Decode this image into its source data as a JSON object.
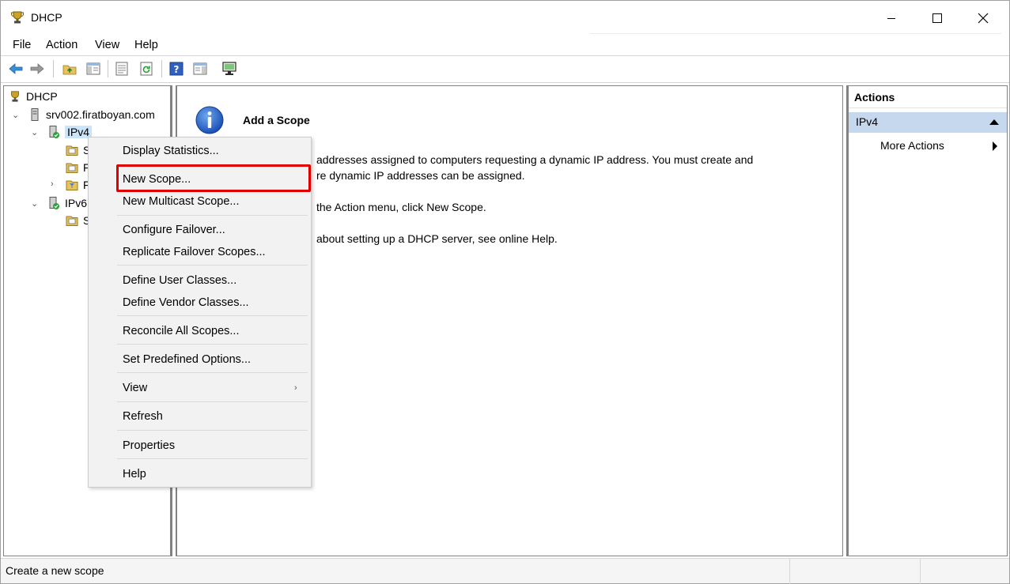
{
  "window": {
    "title": "DHCP"
  },
  "titlebar": {
    "min_icon": "minimize-icon",
    "max_icon": "maximize-icon",
    "close_icon": "close-icon"
  },
  "menubar": {
    "items": [
      "File",
      "Action",
      "View",
      "Help"
    ]
  },
  "toolbar": {
    "buttons": [
      "back-arrow-icon",
      "forward-arrow-icon",
      "up-folder-icon",
      "show-hide-tree-icon",
      "properties-icon",
      "refresh-icon",
      "help-icon",
      "show-hide-action-pane-icon",
      "computer-icon"
    ]
  },
  "tree": {
    "root": "DHCP",
    "server": "srv002.firatboyan.com",
    "ipv4": "IPv4",
    "ipv4_child1": "S",
    "ipv4_child2": "F",
    "ipv4_child3": "F",
    "ipv6": "IPv6",
    "ipv6_child1": "S"
  },
  "content": {
    "heading": "Add a Scope",
    "line1": "addresses assigned to computers requesting a dynamic IP address. You must create and",
    "line2": "re dynamic IP addresses can be assigned.",
    "line3": "the Action menu, click New Scope.",
    "line4": "about setting up a DHCP server, see online Help."
  },
  "actions": {
    "header": "Actions",
    "section": "IPv4",
    "more": "More Actions"
  },
  "status": {
    "text": "Create a new scope"
  },
  "context_menu": {
    "items": [
      "Display Statistics...",
      "New Scope...",
      "New Multicast Scope...",
      "Configure Failover...",
      "Replicate Failover Scopes...",
      "Define User Classes...",
      "Define Vendor Classes...",
      "Reconcile All Scopes...",
      "Set Predefined Options...",
      "View",
      "Refresh",
      "Properties",
      "Help"
    ],
    "highlighted": "New Scope...",
    "submenu_glyph": "›"
  },
  "colors": {
    "highlight": "#e00000",
    "selection": "#cce4f7",
    "actions_section": "#c6d8ee"
  }
}
